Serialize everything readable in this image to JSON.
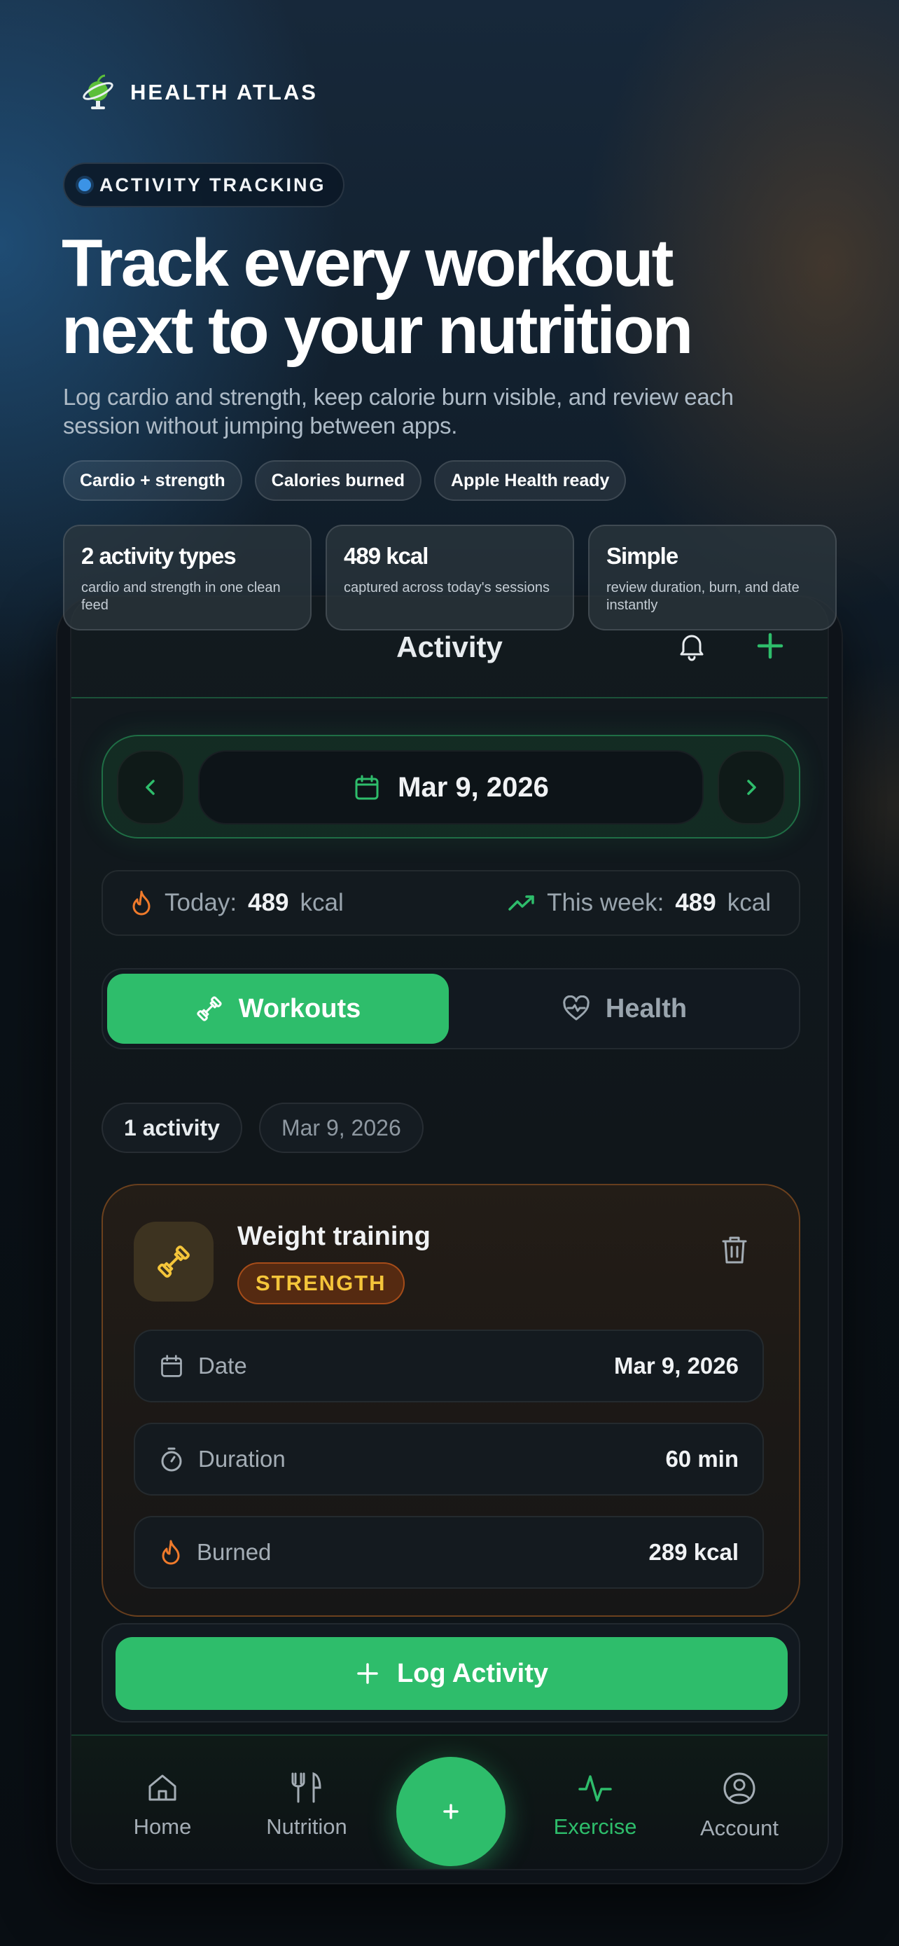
{
  "brand": {
    "name": "HEALTH ATLAS",
    "logo_icon": "globe-apple-icon"
  },
  "hero": {
    "tag": "ACTIVITY TRACKING",
    "title_line1": "Track every workout",
    "title_line2": "next to your nutrition",
    "subtitle": "Log cardio and strength, keep calorie burn visible, and review each session without jumping between apps.",
    "chips": [
      "Cardio + strength",
      "Calories burned",
      "Apple Health ready"
    ],
    "stats": [
      {
        "title": "2 activity types",
        "desc": "cardio and strength in one clean feed"
      },
      {
        "title": "489 kcal",
        "desc": "captured across today's sessions"
      },
      {
        "title": "Simple",
        "desc": "review duration, burn, and date instantly"
      }
    ]
  },
  "app": {
    "header_title": "Activity",
    "date": "Mar 9, 2026",
    "today_label": "Today:",
    "today_value": "489",
    "today_unit": "kcal",
    "week_label": "This week:",
    "week_value": "489",
    "week_unit": "kcal",
    "tabs": {
      "workouts": "Workouts",
      "health": "Health"
    },
    "filters": {
      "count": "1 activity",
      "date": "Mar 9, 2026"
    },
    "activity": {
      "title": "Weight training",
      "badge": "STRENGTH",
      "rows": [
        {
          "label": "Date",
          "value": "Mar 9, 2026",
          "icon": "calendar-icon"
        },
        {
          "label": "Duration",
          "value": "60 min",
          "icon": "stopwatch-icon"
        },
        {
          "label": "Burned",
          "value": "289 kcal",
          "icon": "flame-icon"
        }
      ]
    },
    "log_button": "Log Activity",
    "nav": {
      "home": "Home",
      "nutrition": "Nutrition",
      "exercise": "Exercise",
      "account": "Account"
    }
  },
  "colors": {
    "accent": "#2ebd6b",
    "flame": "#ef7a2b",
    "badge_text": "#f4c53a",
    "pill_dot": "#3b93e6"
  }
}
